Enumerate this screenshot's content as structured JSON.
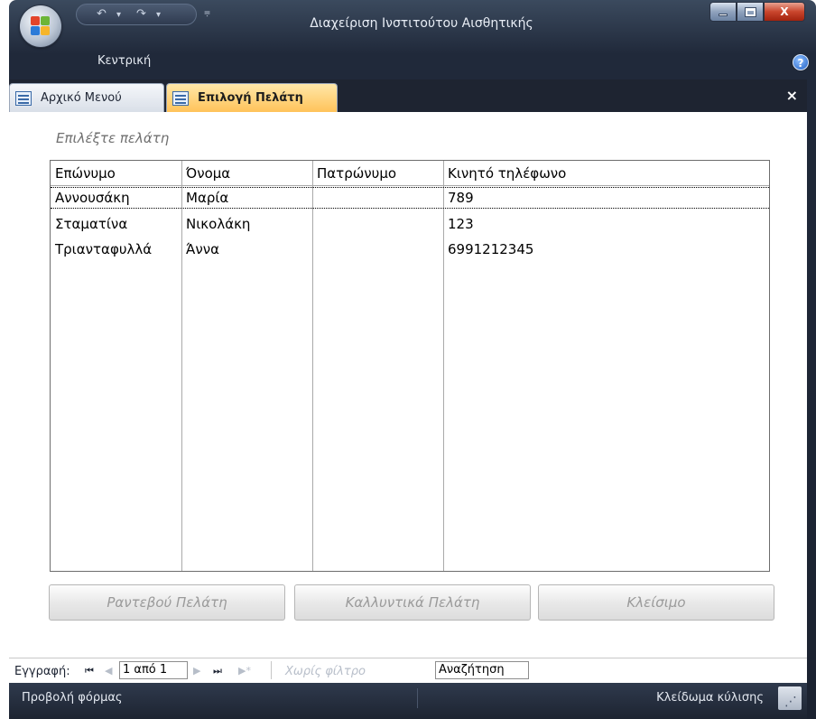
{
  "window": {
    "title": "Διαχείριση Ινστιτούτου Αισθητικής",
    "ribbon_tab": "Κεντρική",
    "qat_undo": "↶",
    "qat_redo": "↷",
    "qat_more": "▾",
    "qat_sep": "⩦",
    "help": "?",
    "min": "",
    "close": "X"
  },
  "tabs": [
    {
      "label": "Αρχικό Μενού"
    },
    {
      "label": "Επιλογή Πελάτη"
    }
  ],
  "doc_close": "×",
  "form": {
    "label": "Επιλέξτε πελάτη",
    "columns": [
      "Επώνυμο",
      "Όνομα",
      "Πατρώνυμο",
      "Κινητό τηλέφωνο"
    ],
    "rows": [
      [
        "Αννουσάκη",
        "Μαρία",
        "",
        "789"
      ],
      [
        "Σταματίνα",
        "Νικολάκη",
        "",
        "123"
      ],
      [
        "Τριανταφυλλά",
        "Άννα",
        "",
        "6991212345"
      ]
    ],
    "buttons": {
      "appointment": "Ραντεβού Πελάτη",
      "cosmetics": "Καλλυντικά Πελάτη",
      "close": "Κλείσιμο"
    }
  },
  "navigation": {
    "record_label": "Εγγραφή:",
    "first": "⏮",
    "prev": "◀",
    "position": "1 από 1",
    "next": "▶",
    "last": "⏭",
    "new": "▶*",
    "filter": "Χωρίς φίλτρο",
    "search": "Αναζήτηση"
  },
  "status": {
    "view": "Προβολή φόρμας",
    "scroll_lock": "Κλείδωμα κύλισης"
  },
  "colors": {
    "active_tab": "#ffc35a",
    "window_frame": "#20293a"
  }
}
